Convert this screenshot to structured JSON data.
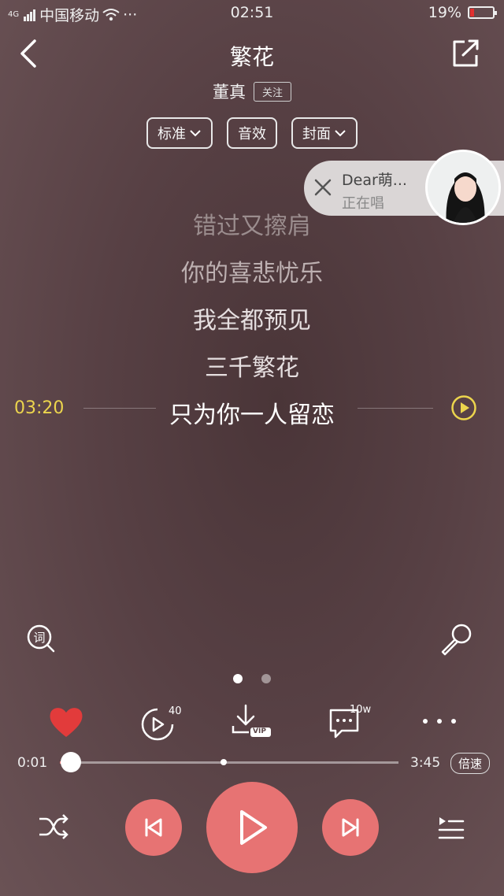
{
  "status_bar": {
    "network": "4G",
    "carrier": "中国移动",
    "extra": "···",
    "time": "02:51",
    "battery_percent": "19%",
    "battery_level": 0.19
  },
  "header": {
    "title": "繁花",
    "artist": "董真",
    "follow_label": "关注"
  },
  "options": [
    {
      "label": "标准",
      "dropdown": true
    },
    {
      "label": "音效",
      "dropdown": false
    },
    {
      "label": "封面",
      "dropdown": true
    }
  ],
  "singer_bubble": {
    "name": "Dear萌...",
    "status": "正在唱"
  },
  "lyrics": {
    "lines": [
      "错过又擦肩",
      "你的喜悲忧乐",
      "我全都预见",
      "三千繁花"
    ],
    "current": "只为你一人留恋",
    "current_time": "03:20"
  },
  "actions": {
    "video_count": "40",
    "comment_count": "10w",
    "download_badge": "VIP"
  },
  "progress": {
    "elapsed": "0:01",
    "total": "3:45",
    "fraction": 0.005,
    "buffered_fraction": 0.48,
    "speed_label": "倍速"
  },
  "page_indicator": {
    "pages": 2,
    "active": 0
  },
  "colors": {
    "accent": "#e77373",
    "like": "#e23b3b",
    "highlight_time": "#ecd54d"
  }
}
